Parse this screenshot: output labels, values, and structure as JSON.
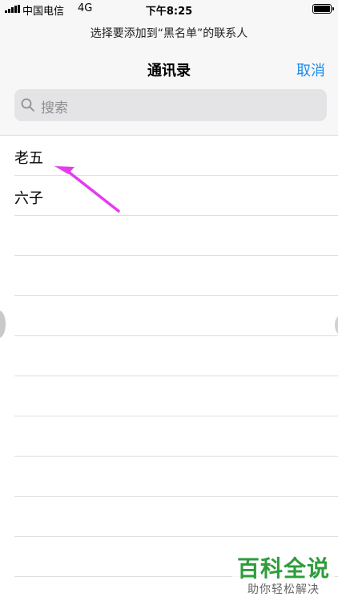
{
  "status_bar": {
    "carrier": "中国电信",
    "network": "4G",
    "time": "下午8:25",
    "battery_level": 0.9
  },
  "header": {
    "prompt": "选择要添加到“黑名单”的联系人",
    "title": "通讯录",
    "cancel_label": "取消",
    "accent_color": "#1a8cf0"
  },
  "search": {
    "placeholder": "搜索"
  },
  "contacts": [
    {
      "name": "老五"
    },
    {
      "name": "六子"
    },
    {
      "name": ""
    },
    {
      "name": ""
    },
    {
      "name": ""
    },
    {
      "name": ""
    },
    {
      "name": ""
    },
    {
      "name": ""
    },
    {
      "name": ""
    },
    {
      "name": ""
    },
    {
      "name": ""
    }
  ],
  "annotation": {
    "arrow_color": "#e43cf0",
    "icon": "pointer-arrow-icon"
  },
  "watermark": {
    "title": "百科全说",
    "subtitle": "助你轻松解决"
  }
}
